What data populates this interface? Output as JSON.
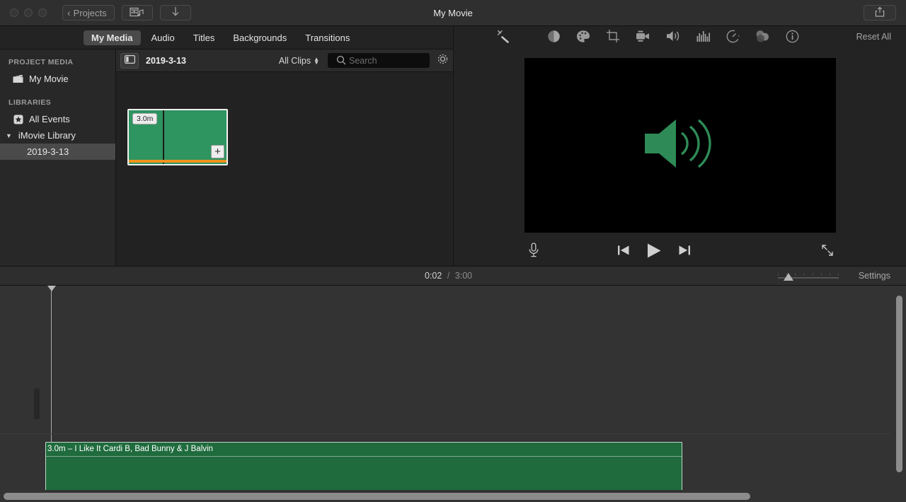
{
  "window": {
    "title": "My Movie",
    "back_button": "Projects",
    "media_button_icon": "filmstrip-music-icon",
    "download_button_icon": "download-arrow-icon",
    "share_button_icon": "share-export-icon"
  },
  "browser_tabs": [
    {
      "label": "My Media",
      "active": true
    },
    {
      "label": "Audio",
      "active": false
    },
    {
      "label": "Titles",
      "active": false
    },
    {
      "label": "Backgrounds",
      "active": false
    },
    {
      "label": "Transitions",
      "active": false
    }
  ],
  "sidebar": {
    "project_media_header": "PROJECT MEDIA",
    "project_item": {
      "label": "My Movie",
      "icon": "clapperboard-icon"
    },
    "libraries_header": "LIBRARIES",
    "all_events": {
      "label": "All Events",
      "icon": "star-box-icon"
    },
    "library": {
      "label": "iMovie Library",
      "icon": "disclosure-triangle-icon"
    },
    "event": {
      "label": "2019-3-13",
      "selected": true
    }
  },
  "browser": {
    "sidebar_toggle_icon": "sidebar-toggle-icon",
    "event_title": "2019-3-13",
    "filter_label": "All Clips",
    "filter_stepper_icon": "stepper-updown-icon",
    "search_placeholder": "Search",
    "search_value": "",
    "search_icon": "search-icon",
    "settings_icon": "gear-icon",
    "clip": {
      "duration_badge": "3.0m",
      "add_button": "+",
      "color": "#2e9460",
      "audio_strip_color": "#f0921e"
    }
  },
  "viewer": {
    "magic_wand_icon": "magic-wand-icon",
    "adjust_icons": [
      "color-balance-icon",
      "color-correction-icon",
      "crop-icon",
      "stabilization-icon",
      "volume-icon",
      "equalizer-icon",
      "speed-icon",
      "filters-icon",
      "info-icon"
    ],
    "reset_all": "Reset All",
    "preview_icon": "speaker-waves-icon",
    "preview_icon_color": "#2e8b57",
    "preview_background": "#000000",
    "transport": {
      "voiceover_icon": "microphone-icon",
      "previous_icon": "skip-previous-icon",
      "play_icon": "play-icon",
      "next_icon": "skip-next-icon",
      "fullscreen_icon": "expand-arrows-icon"
    }
  },
  "status": {
    "current_time": "0:02",
    "separator": "/",
    "total_time": "3:00",
    "zoom_slider_value": 10,
    "settings_label": "Settings"
  },
  "timeline": {
    "playhead_position": "0:02",
    "clip": {
      "label": "3.0m – I Like It Cardi B, Bad Bunny & J Balvin",
      "color": "#1f6b3d",
      "border_color": "#bfd8c8"
    }
  }
}
